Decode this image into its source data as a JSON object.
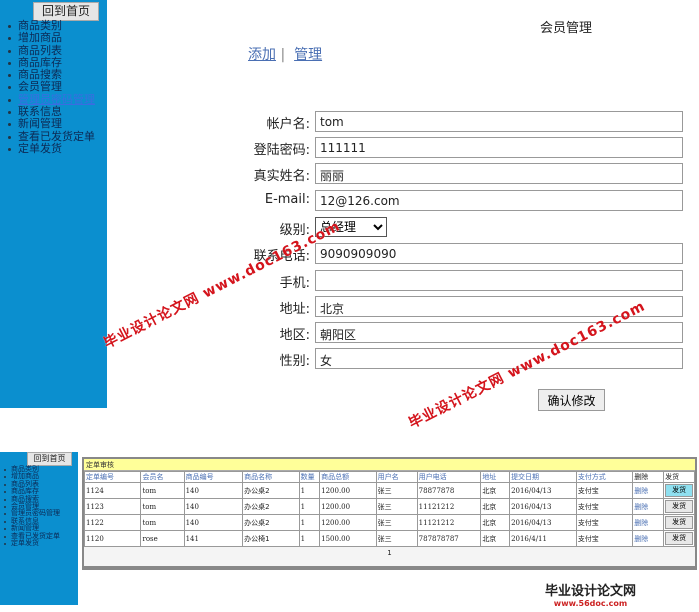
{
  "sidebar": {
    "home": "回到首页",
    "items": [
      "商品类别",
      "增加商品",
      "商品列表",
      "商品库存",
      "商品搜索",
      "会员管理",
      "管理员密码管理",
      "联系信息",
      "新闻管理",
      "查看已发货定单",
      "定单发货"
    ]
  },
  "member": {
    "title": "会员管理",
    "add": "添加",
    "sep": "|",
    "manage": "管理",
    "fields": [
      {
        "label": "帐户名:",
        "value": "tom"
      },
      {
        "label": "登陆密码:",
        "value": "111111"
      },
      {
        "label": "真实姓名:",
        "value": "丽丽"
      },
      {
        "label": "E-mail:",
        "value": "12@126.com"
      },
      {
        "label": "级别:",
        "value": "总经理"
      },
      {
        "label": "联系电话:",
        "value": "9090909090"
      },
      {
        "label": "手机:",
        "value": ""
      },
      {
        "label": "地址:",
        "value": "北京"
      },
      {
        "label": "地区:",
        "value": "朝阳区"
      },
      {
        "label": "性别:",
        "value": "女"
      }
    ],
    "submit": "确认修改"
  },
  "watermarks": [
    "毕业设计论文网",
    "www.doc163.com"
  ],
  "orders": {
    "caption": "定单审核",
    "headers": [
      "定单编号",
      "会员名",
      "商品编号",
      "商品名称",
      "数量",
      "商品总额",
      "用户名",
      "用户电话",
      "地址",
      "提交日期",
      "支付方式",
      "删除",
      "发货"
    ],
    "rows": [
      [
        "1124",
        "tom",
        "140",
        "办公桌2",
        "1",
        "1200.00",
        "张三",
        "78877878",
        "北京",
        "2016/04/13",
        "支付宝",
        "删除",
        "发货"
      ],
      [
        "1123",
        "tom",
        "140",
        "办公桌2",
        "1",
        "1200.00",
        "张三",
        "11121212",
        "北京",
        "2016/04/13",
        "支付宝",
        "删除",
        "发货"
      ],
      [
        "1122",
        "tom",
        "140",
        "办公桌2",
        "1",
        "1200.00",
        "张三",
        "11121212",
        "北京",
        "2016/04/13",
        "支付宝",
        "删除",
        "发货"
      ],
      [
        "1120",
        "rose",
        "141",
        "办公椅1",
        "1",
        "1500.00",
        "张三",
        "787878787",
        "北京",
        "2016/4/11",
        "支付宝",
        "删除",
        "发货"
      ]
    ],
    "page": "1"
  },
  "logo": {
    "name": "毕业设计论文网",
    "url": "www.56doc.com"
  }
}
